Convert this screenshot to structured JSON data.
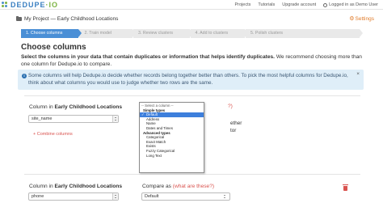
{
  "app": {
    "logo_main": "DEDUPE",
    "logo_sep": "·",
    "logo_suffix": "IO",
    "brand_colors": {
      "primary": "#3a7fc1",
      "accent": "#7cb342",
      "link_red": "#d9534f",
      "settings_orange": "#e07b2a"
    }
  },
  "navbar": {
    "links": [
      "Projects",
      "Tutorials",
      "Upgrade account"
    ],
    "user_label": "Logged in as Demo User",
    "user_icon": "user-icon"
  },
  "breadcrumb": {
    "icon": "folder-icon",
    "text": "My Project — Early Childhood Locations"
  },
  "settings": {
    "icon": "gear-icon",
    "label": "Settings"
  },
  "steps": [
    {
      "label": "1. Choose columns",
      "active": true
    },
    {
      "label": "2. Train model",
      "active": false
    },
    {
      "label": "3. Review clusters",
      "active": false
    },
    {
      "label": "4. Add to clusters",
      "active": false
    },
    {
      "label": "5. Polish clusters",
      "active": false
    }
  ],
  "page": {
    "heading": "Choose columns",
    "intro_bold": "Select the columns in your data that contain duplicates or information that helps identify duplicates.",
    "intro_rest": " We recommend choosing more than one column for Dedupe.io to compare."
  },
  "info": {
    "icon": "info-icon",
    "text": "Some columns will help Dedupe.io decide whether records belong together better than others. To pick the most helpful columns for Dedupe.io, think about what columns you would use to judge whether two rows are the same.",
    "close": "×"
  },
  "column_card_1": {
    "label_prefix": "Column in ",
    "label_dataset": "Early Childhood Locations",
    "selected_field": "site_name",
    "combine_label": "+ Combine columns",
    "question_peek": "?)",
    "under_text_1": "ether",
    "under_text_2": "tor"
  },
  "column_card_2": {
    "label_prefix": "Column in ",
    "label_dataset": "Early Childhood Locations",
    "selected_field": "phone",
    "compare_label": "Compare as ",
    "compare_link": "(what are these?)",
    "compare_selected": "Default",
    "delete_icon": "trash-icon"
  },
  "compare_dropdown": {
    "items": [
      {
        "text": "-- Select a column --",
        "kind": "header"
      },
      {
        "text": "Simple types",
        "kind": "group"
      },
      {
        "text": "Default",
        "kind": "option",
        "selected": true
      },
      {
        "text": "Address",
        "kind": "option"
      },
      {
        "text": "Name",
        "kind": "option"
      },
      {
        "text": "Dates and Times",
        "kind": "option"
      },
      {
        "text": "Advanced types",
        "kind": "group"
      },
      {
        "text": "Categorical",
        "kind": "option"
      },
      {
        "text": "Exact Match",
        "kind": "option"
      },
      {
        "text": "Exists",
        "kind": "option"
      },
      {
        "text": "Fuzzy Categorical",
        "kind": "option"
      },
      {
        "text": "Long Text",
        "kind": "option"
      }
    ],
    "check_mark": "✓"
  }
}
